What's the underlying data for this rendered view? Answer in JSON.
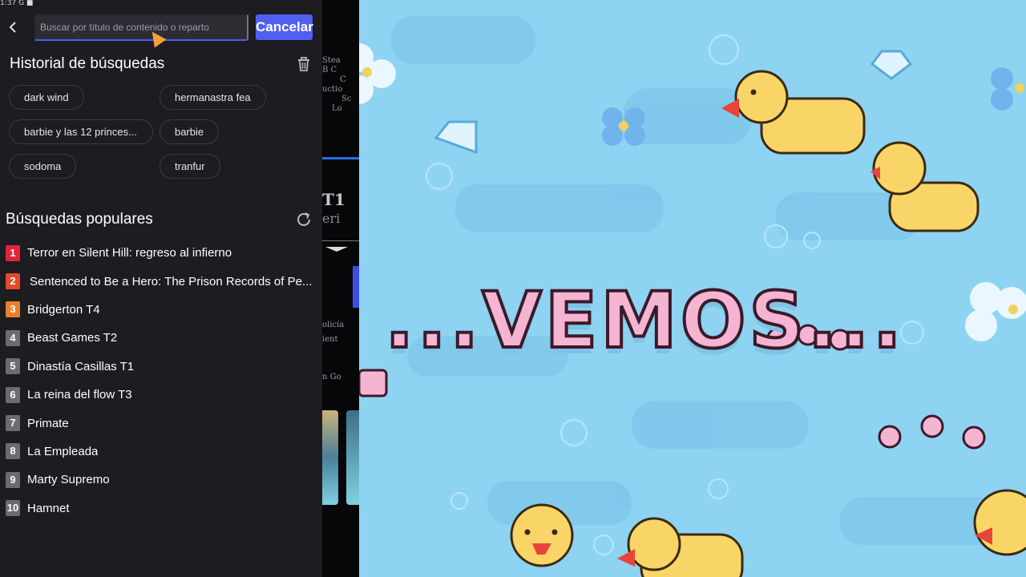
{
  "status_bar": {
    "text": "1:37 G ■"
  },
  "search": {
    "placeholder": "Buscar por título de contenido o reparto",
    "cancel_label": "Cancelar"
  },
  "history": {
    "title": "Historial de búsquedas",
    "items": [
      "dark wind",
      "hermanastra fea",
      "barbie y las 12 princes...",
      "barbie",
      "sodoma",
      "tranfur"
    ]
  },
  "popular": {
    "title": "Búsquedas populares",
    "items": [
      {
        "rank": "1",
        "title": "Terror en Silent Hill: regreso al infierno",
        "badge_color": "#e0253a"
      },
      {
        "rank": "2",
        "title": "Sentenced to Be a Hero: The Prison Records of Pe...",
        "badge_color": "#e14a2c"
      },
      {
        "rank": "3",
        "title": "Bridgerton T4",
        "badge_color": "#e8822a"
      },
      {
        "rank": "4",
        "title": "Beast Games T2",
        "badge_color": "#6b6b70"
      },
      {
        "rank": "5",
        "title": "Dinastía Casillas T1",
        "badge_color": "#6b6b70"
      },
      {
        "rank": "6",
        "title": "La reina del flow T3",
        "badge_color": "#6b6b70"
      },
      {
        "rank": "7",
        "title": "Primate",
        "badge_color": "#6b6b70"
      },
      {
        "rank": "8",
        "title": "La Empleada",
        "badge_color": "#6b6b70"
      },
      {
        "rank": "9",
        "title": "Marty Supremo",
        "badge_color": "#6b6b70"
      },
      {
        "rank": "10",
        "title": "Hamnet",
        "badge_color": "#6b6b70"
      }
    ]
  },
  "background_strip": {
    "lines": [
      "Stea",
      "B C",
      "C",
      "uctio",
      "Sc",
      "Lo",
      "T1",
      "eri",
      "olicía",
      "ient",
      "n Go"
    ]
  },
  "game": {
    "banner": "...VEMOS...",
    "colors": {
      "water": "#8fd3f2",
      "banner_pink": "#f4b4d2",
      "duck_yellow": "#f9d567",
      "beak": "#e8443a"
    }
  },
  "icons": [
    "back-arrow-icon",
    "trash-icon",
    "refresh-icon",
    "mouse-cursor-icon"
  ]
}
